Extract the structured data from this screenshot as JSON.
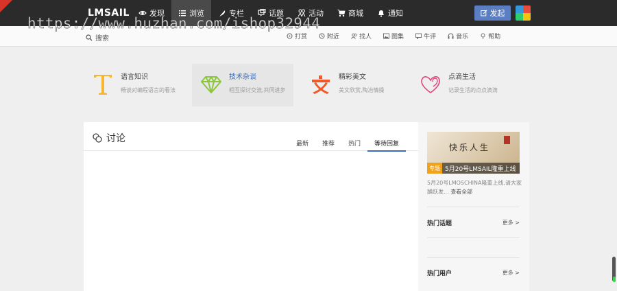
{
  "app": {
    "logo": "LMSAIL"
  },
  "watermark": "https://www.huzhan.com/ishop32944",
  "nav": [
    {
      "label": "发现",
      "icon": "eye-icon",
      "active": false
    },
    {
      "label": "浏览",
      "icon": "list-icon",
      "active": true
    },
    {
      "label": "专栏",
      "icon": "feather-icon",
      "active": false
    },
    {
      "label": "话题",
      "icon": "chat-icon",
      "active": false
    },
    {
      "label": "活动",
      "icon": "people-icon",
      "active": false
    },
    {
      "label": "商城",
      "icon": "cart-icon",
      "active": false
    },
    {
      "label": "通知",
      "icon": "bell-icon",
      "active": false
    }
  ],
  "header": {
    "post_label": "发起"
  },
  "search": {
    "placeholder": "搜索"
  },
  "subnav": [
    {
      "label": "打赏",
      "icon": "coin-icon"
    },
    {
      "label": "附近",
      "icon": "clock-icon"
    },
    {
      "label": "找人",
      "icon": "user-icon"
    },
    {
      "label": "图集",
      "icon": "image-icon"
    },
    {
      "label": "牛评",
      "icon": "comment-icon"
    },
    {
      "label": "音乐",
      "icon": "headphones-icon"
    },
    {
      "label": "帮助",
      "icon": "pin-icon"
    }
  ],
  "categories": [
    {
      "title": "语言知识",
      "desc": "畅谈对编程语言的看法",
      "icon": "letter-t-icon",
      "color": "#f5b731",
      "active": false
    },
    {
      "title": "技术杂谈",
      "desc": "相互探讨交流,共同进步",
      "icon": "diamond-icon",
      "color": "#8cc63e",
      "active": true
    },
    {
      "title": "精彩美文",
      "desc": "美文欣赏,陶冶情操",
      "icon": "wen-icon",
      "color": "#f05a28",
      "active": false
    },
    {
      "title": "点滴生活",
      "desc": "记录生活的点点滴滴",
      "icon": "hearts-icon",
      "color": "#e0457b",
      "active": false
    }
  ],
  "discuss": {
    "title": "讨论",
    "tabs": [
      {
        "label": "最新",
        "active": false
      },
      {
        "label": "推荐",
        "active": false
      },
      {
        "label": "热门",
        "active": false
      },
      {
        "label": "等待回复",
        "active": true
      }
    ]
  },
  "sidebar": {
    "banner": {
      "art_text": "快乐人生",
      "tag": "专题",
      "caption": "5月20号LMSAIL隆重上线"
    },
    "summary": "5月20号LMOSCHINA隆重上线,请大家踊跃发...",
    "summary_more": "查看全部",
    "hot_topics": {
      "title": "热门话题",
      "more": "更多 >"
    },
    "hot_users": {
      "title": "热门用户",
      "more": "更多 >"
    }
  },
  "colors": {
    "topbar": "#2b2b2b",
    "accent": "#3b6bb5",
    "post_button": "#5b7dc1"
  }
}
